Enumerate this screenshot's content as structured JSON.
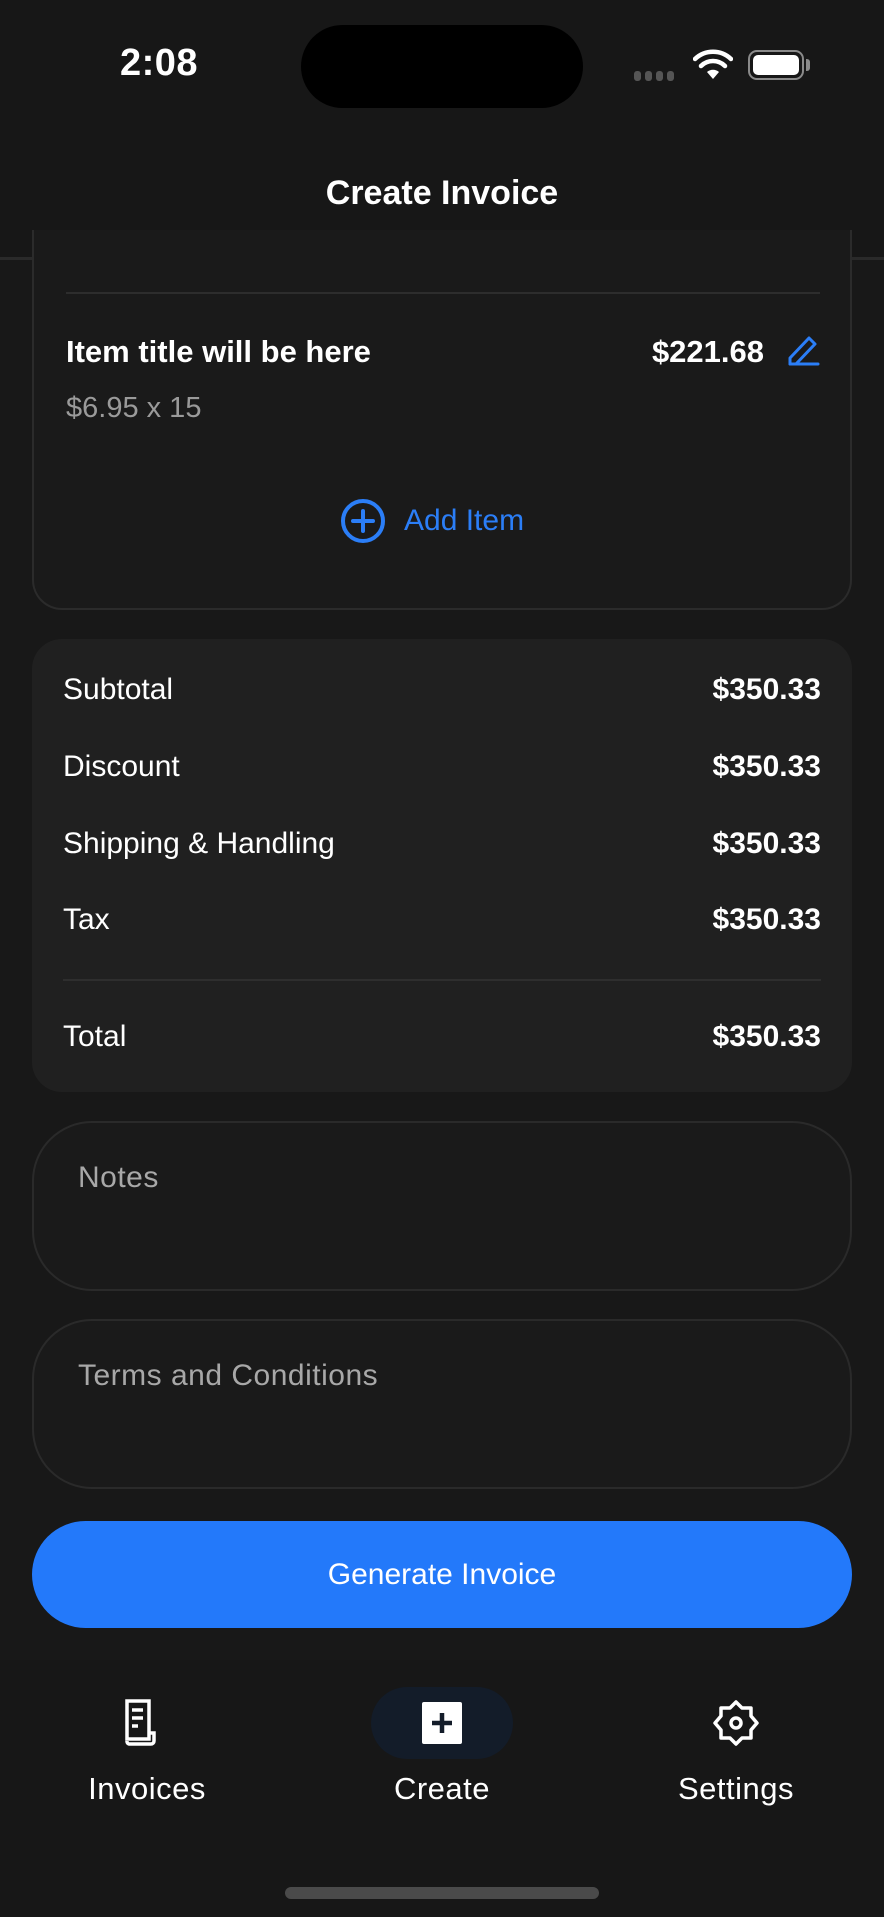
{
  "status_bar": {
    "time": "2:08"
  },
  "header": {
    "title": "Create Invoice"
  },
  "items": {
    "list": [
      {
        "title": "Item title will be here",
        "total": "$221.68",
        "detail": "$6.95 x 15"
      }
    ],
    "add_item_label": "Add Item"
  },
  "totals": {
    "rows": [
      {
        "label": "Subtotal",
        "value": "$350.33"
      },
      {
        "label": "Discount",
        "value": "$350.33"
      },
      {
        "label": "Shipping & Handling",
        "value": "$350.33"
      },
      {
        "label": "Tax",
        "value": "$350.33"
      }
    ],
    "total": {
      "label": "Total",
      "value": "$350.33"
    }
  },
  "notes": {
    "placeholder": "Notes",
    "value": ""
  },
  "terms": {
    "placeholder": "Terms and Conditions",
    "value": ""
  },
  "generate_button": {
    "label": "Generate Invoice"
  },
  "tabbar": {
    "tabs": [
      {
        "label": "Invoices",
        "icon": "invoice-icon",
        "active": false
      },
      {
        "label": "Create",
        "icon": "create-icon",
        "active": true
      },
      {
        "label": "Settings",
        "icon": "gear-icon",
        "active": false
      }
    ]
  },
  "colors": {
    "accent": "#2379fa",
    "background": "#181818",
    "card": "#202020",
    "muted_text": "#9a9a9a"
  }
}
